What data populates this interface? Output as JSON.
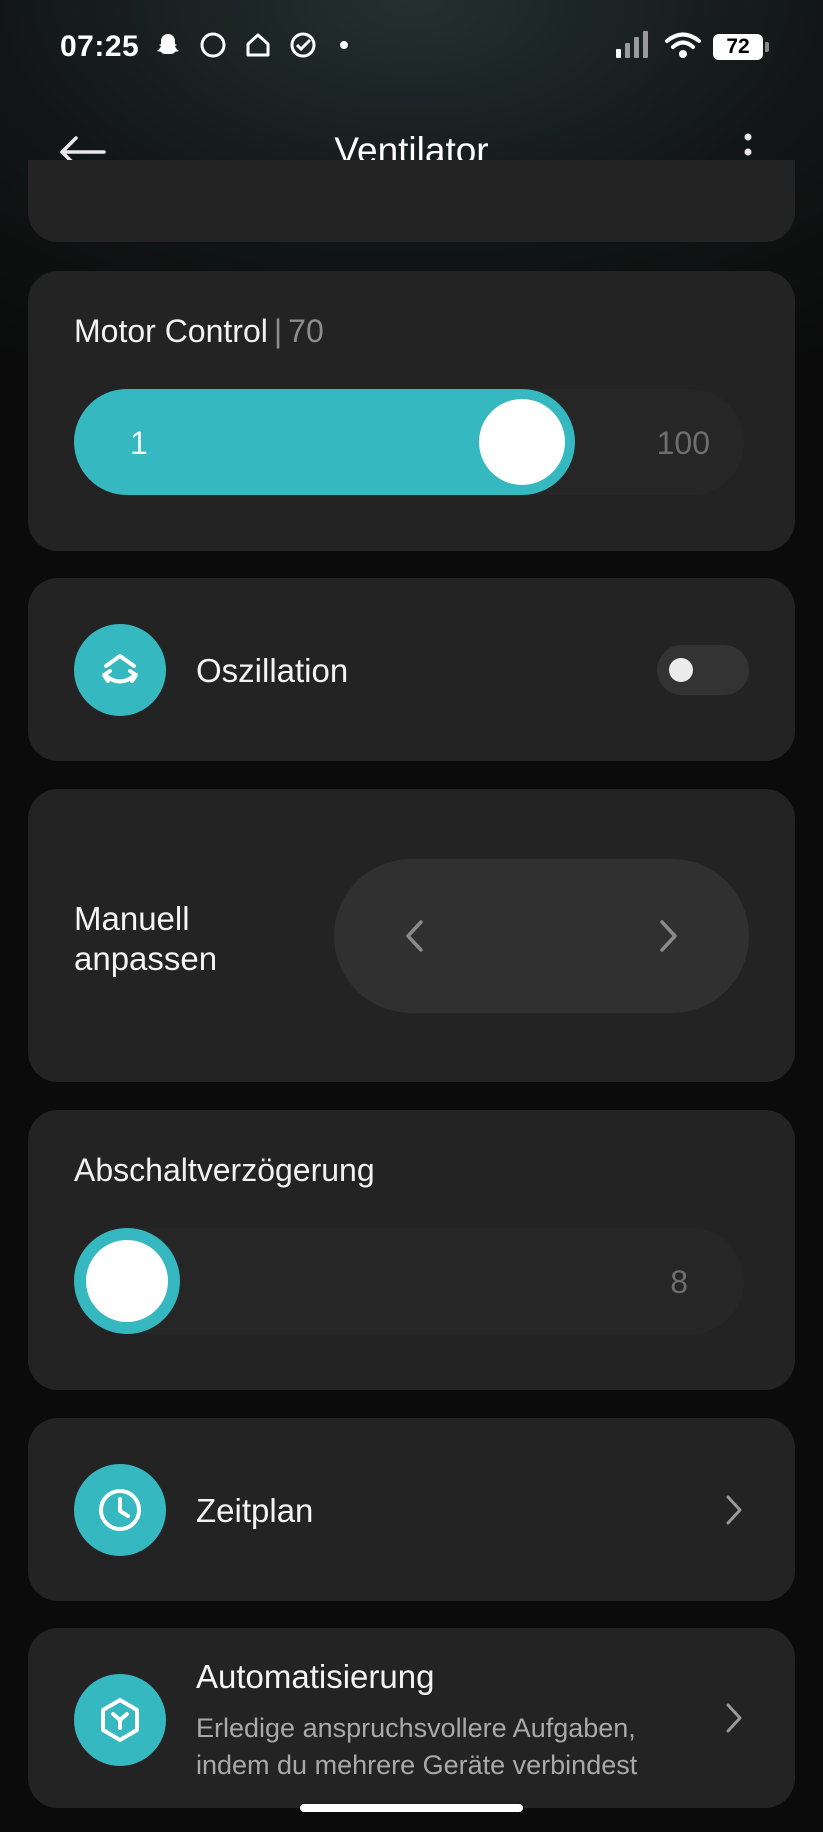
{
  "status_bar": {
    "time": "07:25",
    "battery": "72",
    "left_icons": [
      "snapchat-icon",
      "circle-icon",
      "home-icon",
      "check-circle-icon",
      "dot-icon"
    ],
    "right_icons": [
      "signal-icon",
      "wifi-icon",
      "battery-icon"
    ]
  },
  "app_bar": {
    "title": "Ventilator"
  },
  "motor_control": {
    "label": "Motor Control",
    "separator": "|",
    "value": "70",
    "min": "1",
    "max": "100",
    "fill_fraction": 0.7,
    "accent": "#35b8bf"
  },
  "oscillation": {
    "label": "Oszillation",
    "enabled": false
  },
  "manual": {
    "label_line1": "Manuell",
    "label_line2": "anpassen"
  },
  "shutdown_delay": {
    "label": "Abschaltverzögerung",
    "max": "8",
    "fill_fraction": 0.0
  },
  "schedule": {
    "label": "Zeitplan"
  },
  "automation": {
    "title": "Automatisierung",
    "desc_line1": "Erledige anspruchsvollere Aufgaben,",
    "desc_line2": "indem du mehrere Geräte verbindest"
  }
}
